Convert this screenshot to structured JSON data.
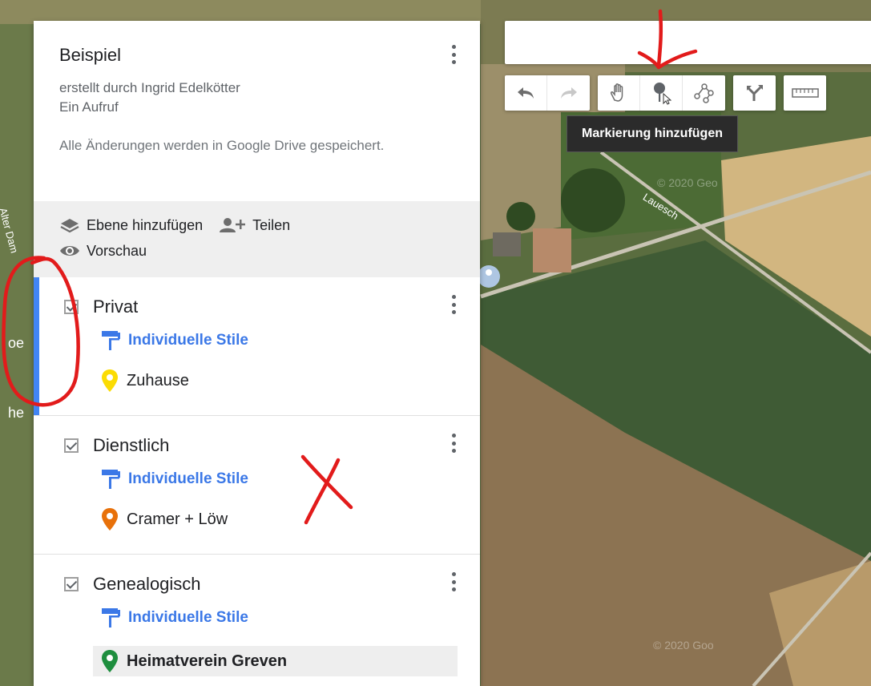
{
  "map": {
    "labels": [
      "Lauesch",
      "oe",
      "he",
      "Alter Dam"
    ],
    "watermarks": [
      "© 2020 Geo",
      "© 2020 Goo"
    ]
  },
  "panel": {
    "title": "Beispiel",
    "created_by": "erstellt durch Ingrid Edelkötter",
    "description": "Ein Aufruf",
    "saved_note": "Alle Änderungen werden in Google Drive gespeichert.",
    "actions": {
      "add_layer": "Ebene hinzufügen",
      "share": "Teilen",
      "preview": "Vorschau"
    },
    "layers": [
      {
        "name": "Privat",
        "style": "Individuelle Stile",
        "place": "Zuhause",
        "pin_color": "#fbdc04"
      },
      {
        "name": "Dienstlich",
        "style": "Individuelle Stile",
        "place": "Cramer + Löw",
        "pin_color": "#e8710a"
      },
      {
        "name": "Genealogisch",
        "style": "Individuelle Stile",
        "place": "Heimatverein Greven",
        "pin_color": "#1e8e3e"
      }
    ]
  },
  "toolbar": {
    "tools": [
      "undo-icon",
      "redo-icon",
      "hand-icon",
      "marker-icon",
      "line-icon",
      "route-icon",
      "ruler-icon"
    ],
    "tooltip": "Markierung hinzufügen"
  },
  "annotation_color": "#e21b1b",
  "accent_color": "#4285f4"
}
